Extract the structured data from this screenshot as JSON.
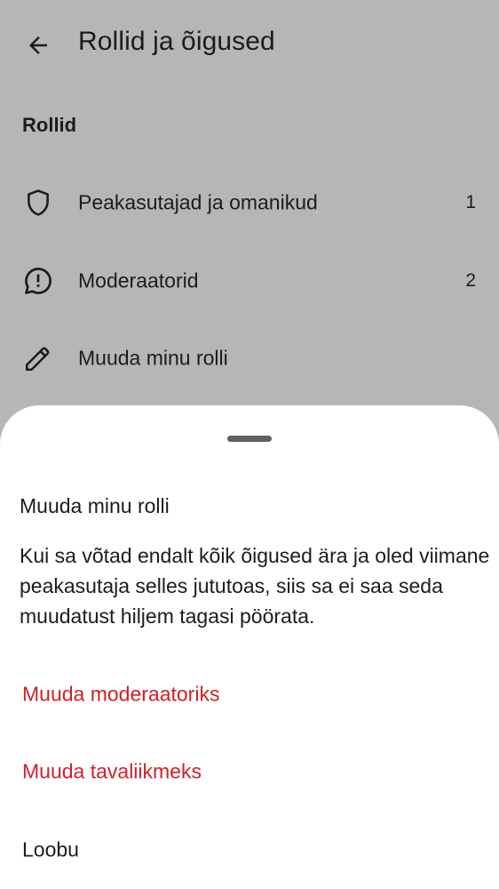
{
  "header": {
    "title": "Rollid ja õigused",
    "back_icon": "arrow-left-icon"
  },
  "roles": {
    "section_title": "Rollid",
    "items": [
      {
        "label": "Peakasutajad ja omanikud",
        "count": "1",
        "icon": "shield-icon"
      },
      {
        "label": "Moderaatorid",
        "count": "2",
        "icon": "chat-alert-icon"
      },
      {
        "label": "Muuda minu rolli",
        "icon": "pencil-icon"
      }
    ]
  },
  "sheet": {
    "title": "Muuda minu rolli",
    "body": "Kui sa võtad endalt kõik õigused ära ja oled viimane peakasutaja selles jututoas, siis sa ei saa seda muudatust hiljem tagasi pöörata.",
    "actions": [
      {
        "label": "Muuda moderaatoriks",
        "style": "danger"
      },
      {
        "label": "Muuda tavaliikmeks",
        "style": "danger"
      },
      {
        "label": "Loobu",
        "style": "neutral"
      }
    ]
  },
  "colors": {
    "scrim": "#b5b6b8",
    "danger": "#d0202a",
    "text": "#1b1c1e",
    "sheet": "#ffffff"
  }
}
